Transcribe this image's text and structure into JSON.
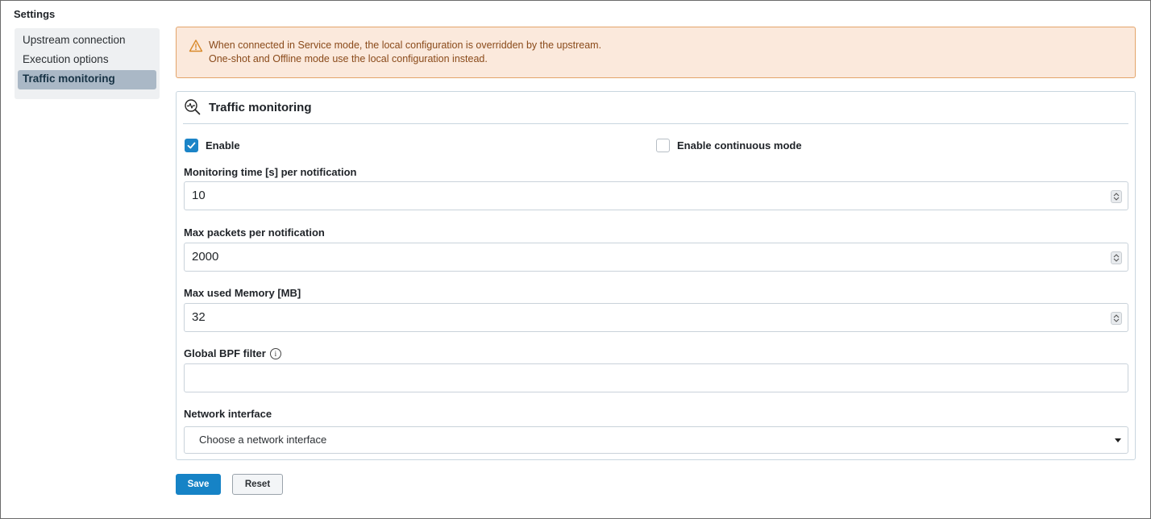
{
  "page": {
    "title": "Settings"
  },
  "sidebar": {
    "items": [
      {
        "label": "Upstream connection",
        "active": false
      },
      {
        "label": "Execution options",
        "active": false
      },
      {
        "label": "Traffic monitoring",
        "active": true
      }
    ]
  },
  "alert": {
    "icon": "warning-triangle-icon",
    "line1": "When connected in Service mode, the local configuration is overridden by the upstream.",
    "line2": "One-shot and Offline mode use the local configuration instead."
  },
  "card": {
    "icon": "traffic-monitor-icon",
    "title": "Traffic monitoring",
    "enable": {
      "label": "Enable",
      "checked": true
    },
    "continuous": {
      "label": "Enable continuous mode",
      "checked": false
    },
    "monitoring_time": {
      "label": "Monitoring time [s] per notification",
      "value": "10"
    },
    "max_packets": {
      "label": "Max packets per notification",
      "value": "2000"
    },
    "max_memory": {
      "label": "Max used Memory [MB]",
      "value": "32"
    },
    "bpf_filter": {
      "label": "Global BPF filter",
      "value": "",
      "info_icon": "info-icon"
    },
    "network_interface": {
      "label": "Network interface",
      "placeholder": "Choose a network interface"
    }
  },
  "actions": {
    "save_label": "Save",
    "reset_label": "Reset"
  },
  "colors": {
    "accent": "#1683c6",
    "alert_bg": "#fbe9dc",
    "alert_border": "#e3a46a",
    "active_nav": "#aab8c6"
  }
}
